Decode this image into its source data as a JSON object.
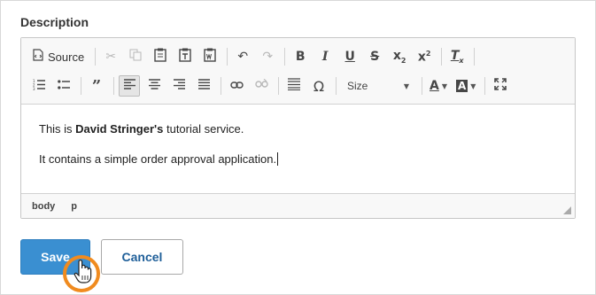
{
  "field_label": "Description",
  "toolbar": {
    "source_label": "Source",
    "size_label": "Size"
  },
  "content": {
    "line1_prefix": "This is ",
    "line1_bold": "David Stringer's",
    "line1_suffix": " tutorial service.",
    "line2": "It contains a simple order approval application."
  },
  "status_path": [
    "body",
    "p"
  ],
  "buttons": {
    "save": "Save",
    "cancel": "Cancel"
  },
  "colors": {
    "save_bg": "#3a8fd1",
    "cancel_text": "#1f5f99",
    "click_highlight": "#f08b1f"
  },
  "icons": [
    "source-icon",
    "cut-icon",
    "copy-icon",
    "paste-icon",
    "paste-text-icon",
    "paste-word-icon",
    "undo-icon",
    "redo-icon",
    "bold-icon",
    "italic-icon",
    "underline-icon",
    "strikethrough-icon",
    "subscript-icon",
    "superscript-icon",
    "remove-format-icon",
    "numbered-list-icon",
    "bulleted-list-icon",
    "blockquote-icon",
    "align-left-icon",
    "align-center-icon",
    "align-right-icon",
    "justify-icon",
    "link-icon",
    "unlink-icon",
    "horizontal-line-icon",
    "special-char-icon",
    "text-color-icon",
    "background-color-icon",
    "maximize-icon"
  ]
}
